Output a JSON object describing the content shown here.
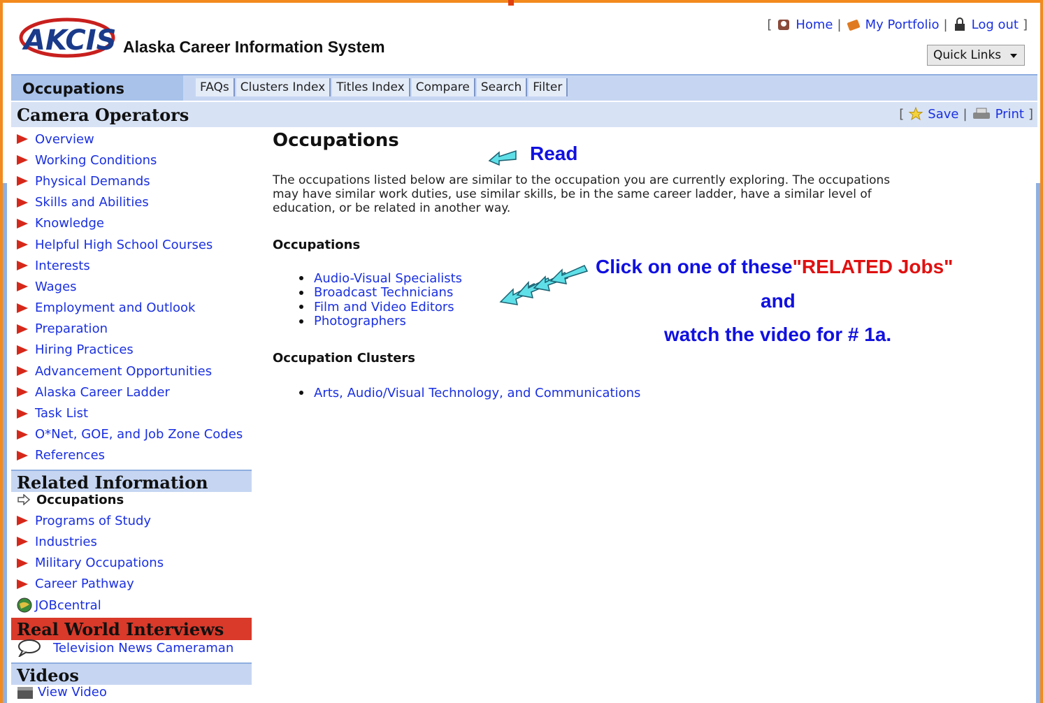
{
  "header": {
    "logo_text": "AKCIS",
    "site_title": "Alaska Career Information System",
    "links": {
      "home": "Home",
      "portfolio": "My Portfolio",
      "logout": "Log out"
    },
    "quick_links": "Quick Links",
    "bracket_open": "[",
    "bracket_close": "]",
    "sep": "|"
  },
  "nav": {
    "section": "Occupations",
    "tabs": [
      "FAQs",
      "Clusters Index",
      "Titles Index",
      "Compare",
      "Search",
      "Filter"
    ]
  },
  "page": {
    "title": "Camera Operators",
    "save": "Save",
    "print": "Print"
  },
  "sidebar": {
    "items": [
      "Overview",
      "Working Conditions",
      "Physical Demands",
      "Skills and Abilities",
      "Knowledge",
      "Helpful High School Courses",
      "Interests",
      "Wages",
      "Employment and Outlook",
      "Preparation",
      "Hiring Practices",
      "Advancement Opportunities",
      "Alaska Career Ladder",
      "Task List",
      "O*Net, GOE, and Job Zone Codes",
      "References"
    ],
    "related_header": "Related Information",
    "related_items": [
      "Occupations",
      "Programs of Study",
      "Industries",
      "Military Occupations",
      "Career Pathway",
      "JOBcentral"
    ],
    "rwi_header": "Real World Interviews",
    "rwi_item": "Television News Cameraman",
    "videos_header": "Videos",
    "video_item": "View Video"
  },
  "content": {
    "title": "Occupations",
    "intro": "The occupations listed below are similar to the occupation you are currently exploring. The occupations may have similar work duties, use similar skills, be in the same career ladder, have a similar level of education, or be related in another way.",
    "occupations_header": "Occupations",
    "occupations": [
      "Audio-Visual Specialists",
      "Broadcast Technicians",
      "Film and Video Editors",
      "Photographers"
    ],
    "clusters_header": "Occupation Clusters",
    "clusters": [
      "Arts, Audio/Visual Technology, and Communications"
    ]
  },
  "annotations": {
    "read": "Read",
    "click_a": "Click on one of these",
    "click_b": "\"RELATED Jobs\"",
    "and": "and",
    "watch": "watch the video for # 1a."
  }
}
